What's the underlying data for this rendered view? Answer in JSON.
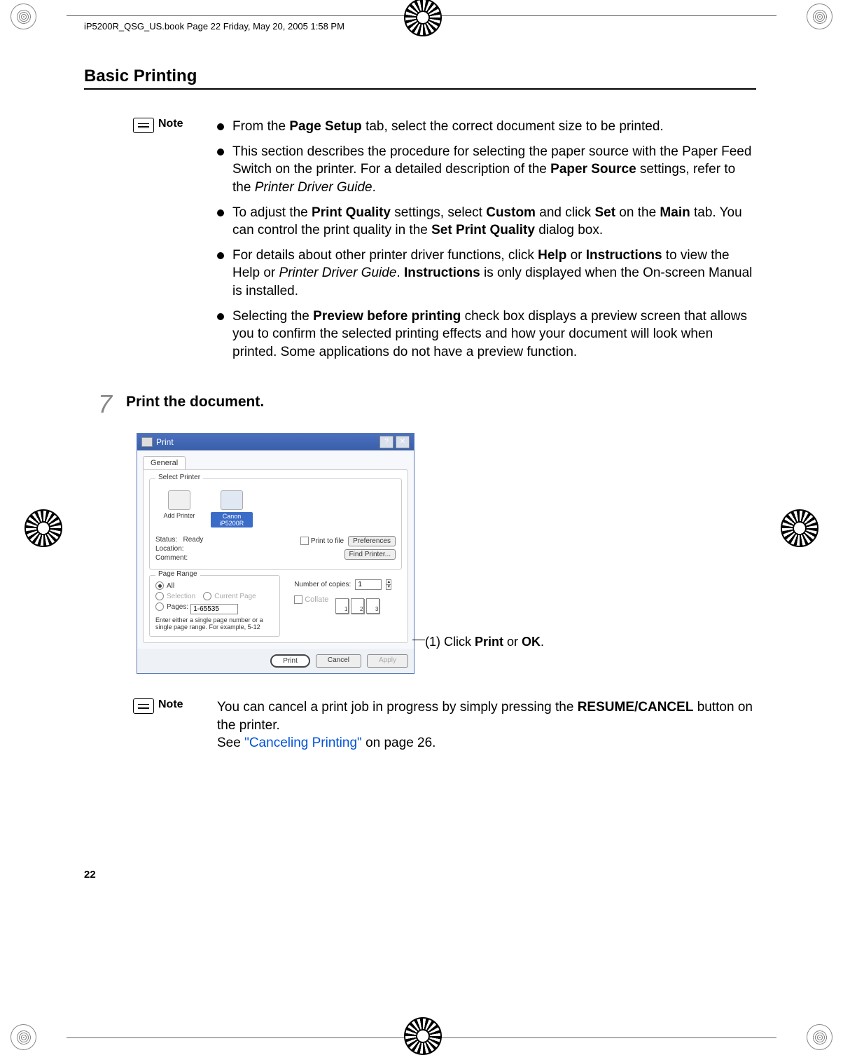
{
  "book_header": "iP5200R_QSG_US.book  Page 22  Friday, May 20, 2005  1:58 PM",
  "section_title": "Basic Printing",
  "note_label": "Note",
  "notes1": {
    "b1_pre": "From the ",
    "b1_bold": "Page Setup",
    "b1_post": " tab, select the correct document size to be printed.",
    "b2_pre": "This section describes the procedure for selecting the paper source with the Paper Feed Switch on the printer. For a detailed description of the ",
    "b2_bold": "Paper Source",
    "b2_mid": " settings, refer to the ",
    "b2_italic": "Printer Driver Guide",
    "b2_post": ".",
    "b3_a": "To adjust the ",
    "b3_b": "Print Quality",
    "b3_c": " settings, select ",
    "b3_d": "Custom",
    "b3_e": " and click ",
    "b3_f": "Set",
    "b3_g": " on the ",
    "b3_h": "Main",
    "b3_i": " tab. You can control the print quality in the ",
    "b3_j": "Set Print Quality",
    "b3_k": " dialog box.",
    "b4_a": "For details about other printer driver functions, click ",
    "b4_b": "Help",
    "b4_c": " or ",
    "b4_d": "Instructions",
    "b4_e": " to view the Help or ",
    "b4_f": "Printer Driver Guide",
    "b4_g": ". ",
    "b4_h": "Instructions",
    "b4_i": " is only displayed when the On-screen Manual is installed.",
    "b5_a": "Selecting the ",
    "b5_b": "Preview before printing",
    "b5_c": " check box displays a preview screen that allows you to confirm the selected printing effects and how your document will look when printed. Some applications do not have a preview function."
  },
  "step": {
    "num": "7",
    "text": "Print the document."
  },
  "dialog": {
    "title": "Print",
    "tab": "General",
    "group_select": "Select Printer",
    "add_printer": "Add Printer",
    "printer_name": "Canon iP5200R",
    "status_lbl": "Status:",
    "status_val": "Ready",
    "location_lbl": "Location:",
    "comment_lbl": "Comment:",
    "print_to_file": "Print to file",
    "preferences": "Preferences",
    "find_printer": "Find Printer...",
    "group_page": "Page Range",
    "all": "All",
    "selection": "Selection",
    "current_page": "Current Page",
    "pages": "Pages:",
    "pages_val": "1-65535",
    "pages_hint": "Enter either a single page number or a single page range.  For example, 5-12",
    "copies_lbl": "Number of copies:",
    "copies_val": "1",
    "collate": "Collate",
    "btn_print": "Print",
    "btn_cancel": "Cancel",
    "btn_apply": "Apply"
  },
  "callout": "(1) Click Print or OK.",
  "callout_bold1": "Print",
  "callout_bold2": "OK",
  "note2_a": "You can cancel a print job in progress by simply pressing the ",
  "note2_b": "RESUME/CANCEL",
  "note2_c": " button on the printer.",
  "note2_d": "See ",
  "note2_link": "\"Canceling Printing\"",
  "note2_e": " on page 26.",
  "page_number": "22"
}
